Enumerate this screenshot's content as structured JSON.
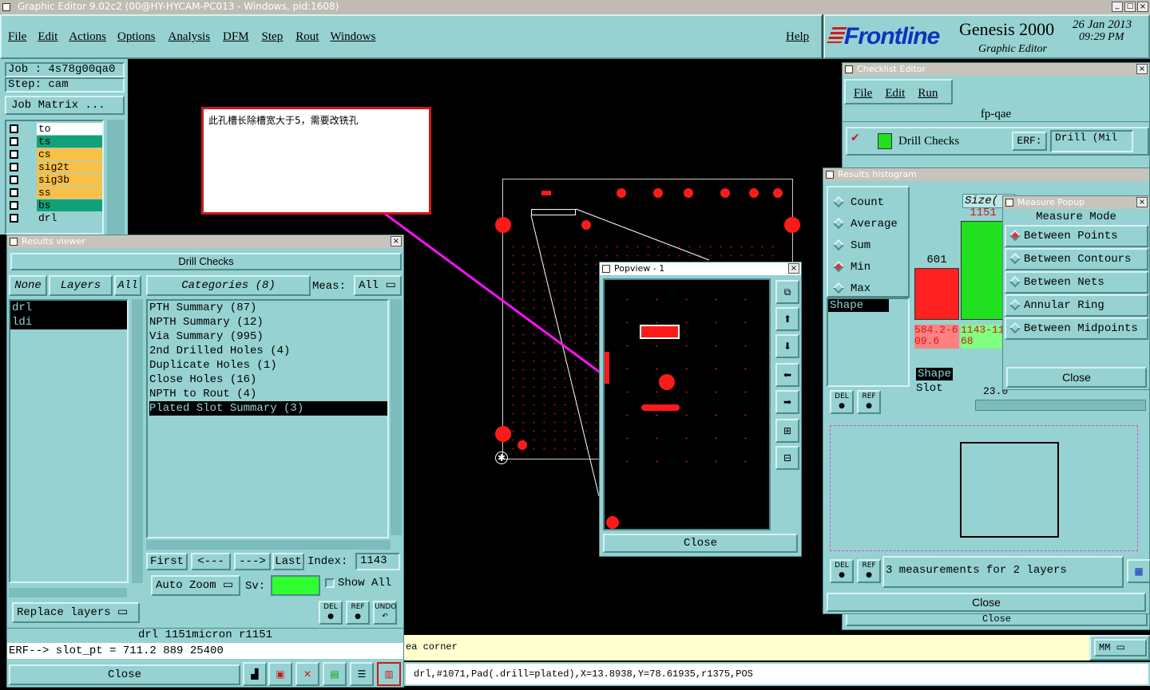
{
  "window_title": "Graphic Editor 9.02c2 (00@HY-HYCAM-PC013 - Windows, pid:1608)",
  "menu": [
    "File",
    "Edit",
    "Actions",
    "Options",
    "Analysis",
    "DFM",
    "Step",
    "Rout",
    "Windows"
  ],
  "help": "Help",
  "brand": {
    "logo": "Frontline",
    "product": "Genesis 2000",
    "sub": "Graphic Editor",
    "date": "26 Jan 2013",
    "time": "09:29 PM"
  },
  "job": "Job : 4s78g00qa0",
  "step": "Step: cam",
  "job_matrix": "Job Matrix ...",
  "layers": [
    {
      "name": "to",
      "color": "#ffffff"
    },
    {
      "name": "ts",
      "color": "#12a078"
    },
    {
      "name": "cs",
      "color": "#f8c048"
    },
    {
      "name": "sig2t",
      "color": "#f8c048"
    },
    {
      "name": "sig3b",
      "color": "#f8c048"
    },
    {
      "name": "ss",
      "color": "#f8c048"
    },
    {
      "name": "bs",
      "color": "#12a078"
    },
    {
      "name": "drl",
      "color": "#96d2d2"
    }
  ],
  "annotation": "此孔槽长除槽宽大于5，需要改铣孔",
  "results_viewer": {
    "title": "Results viewer",
    "header": "Drill Checks",
    "none": "None",
    "layers": "Layers",
    "all": "All",
    "categories": "Categories (8)",
    "meas": "Meas:",
    "meas_val": "All",
    "layer_list": [
      "drl",
      "ldi"
    ],
    "category_list": [
      "PTH Summary (87)",
      "NPTH Summary (12)",
      "Via Summary (995)",
      "2nd Drilled Holes (4)",
      "Duplicate Holes (1)",
      "Close Holes (16)",
      "NPTH to Rout (4)",
      "Plated Slot Summary (3)"
    ],
    "first": "First",
    "prev": "<---",
    "next": "--->",
    "last": "Last",
    "index_label": "Index:",
    "index": "1143",
    "auto_zoom": "Auto Zoom",
    "sv": "Sv:",
    "show_all": "Show All",
    "replace": "Replace layers",
    "status": "drl 1151micron r1151",
    "erf": "ERF--> slot_pt = 711.2 889 25400",
    "close": "Close",
    "del": "DEL",
    "ref": "REF",
    "undo": "UNDO"
  },
  "popview": {
    "title": "Popview - 1",
    "close": "Close"
  },
  "checklist": {
    "title": "Checklist Editor",
    "menu": [
      "File",
      "Edit",
      "Run"
    ],
    "name": "fp-qae",
    "item": "Drill Checks",
    "erf": "ERF:",
    "erf_val": "Drill (Mil",
    "close": "Close"
  },
  "histogram": {
    "title": "Results histogram",
    "stats": [
      "Count",
      "Average",
      "Sum",
      "Min",
      "Max"
    ],
    "selected": "Min",
    "shape": "Shape",
    "shape_slot": "Slot",
    "size": "Size(",
    "bars": [
      {
        "value": 601,
        "range": "584.2-609.6",
        "color": "#ff2020"
      },
      {
        "value": 1151,
        "range": "1143-1168",
        "color": "#20e020"
      }
    ],
    "slider": "23.0",
    "measurements": "3 measurements for 2 layers",
    "close": "Close",
    "del": "DEL",
    "ref": "REF"
  },
  "measure": {
    "title": "Measure Popup",
    "mode": "Measure Mode",
    "options": [
      "Between Points",
      "Between Contours",
      "Between Nets",
      "Annular Ring",
      "Between Midpoints"
    ],
    "selected": "Between Points",
    "close": "Close"
  },
  "status_bar": {
    "hint": "ea corner",
    "units": "MM",
    "info": "drl,#1071,Pad(.drill=plated),X=13.8938,Y=78.61935,r1375,POS"
  }
}
